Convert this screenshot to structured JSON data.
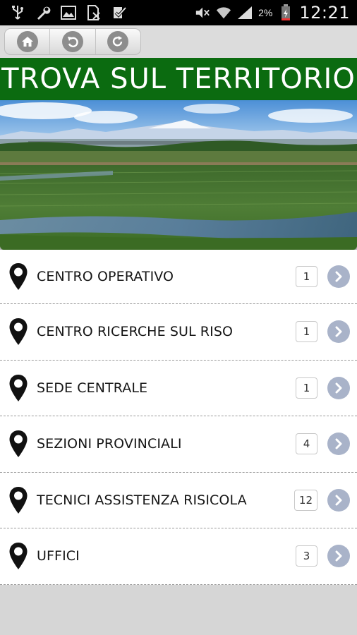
{
  "status_bar": {
    "left_icons": [
      "usb-icon",
      "wrench-icon",
      "image-icon",
      "no-sim-icon",
      "checklist-icon"
    ],
    "right_icons": [
      "mute-icon",
      "wifi-icon",
      "signal-icon",
      "battery-icon"
    ],
    "battery": "2%",
    "time": "12:21"
  },
  "toolbar": {
    "buttons": [
      "home-icon",
      "back-icon",
      "refresh-icon"
    ]
  },
  "header": {
    "title": "TROVA SUL TERRITORIO",
    "color": "#0b6b10"
  },
  "list": {
    "items": [
      {
        "label": "CENTRO OPERATIVO",
        "count": "1"
      },
      {
        "label": "CENTRO RICERCHE SUL RISO",
        "count": "1"
      },
      {
        "label": "SEDE CENTRALE",
        "count": "1"
      },
      {
        "label": "SEZIONI PROVINCIALI",
        "count": "4"
      },
      {
        "label": "TECNICI ASSISTENZA RISICOLA",
        "count": "12"
      },
      {
        "label": "UFFICI",
        "count": "3"
      }
    ],
    "icon": "map-pin-icon",
    "chevron_icon": "chevron-right-icon",
    "chevron_color": "#a9b3c9"
  }
}
